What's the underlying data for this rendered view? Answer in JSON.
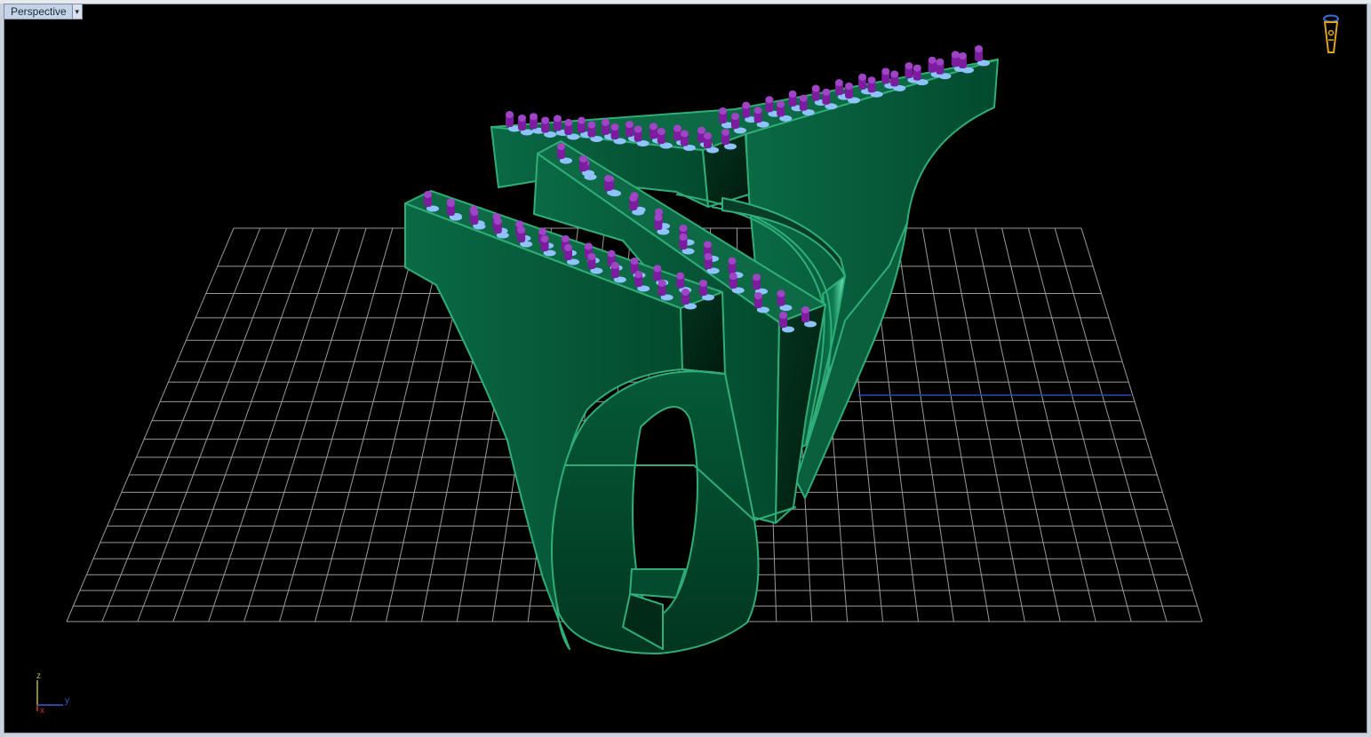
{
  "viewport": {
    "title": "Perspective",
    "menu_glyph": "▾"
  },
  "axis_widget": {
    "z_label": "z",
    "y_label": "y",
    "x_label": "x"
  },
  "icons": {
    "camera": "camera-target-icon",
    "menu": "chevron-down-icon"
  },
  "colors": {
    "background": "#000000",
    "model_surface": "#0b5a3c",
    "model_edges": "#2fae78",
    "prongs": "#7b1d9e",
    "gem_seats": "#8ec3ff",
    "grid": "#9a9a9a",
    "y_axis_line": "#1f4fb6"
  }
}
